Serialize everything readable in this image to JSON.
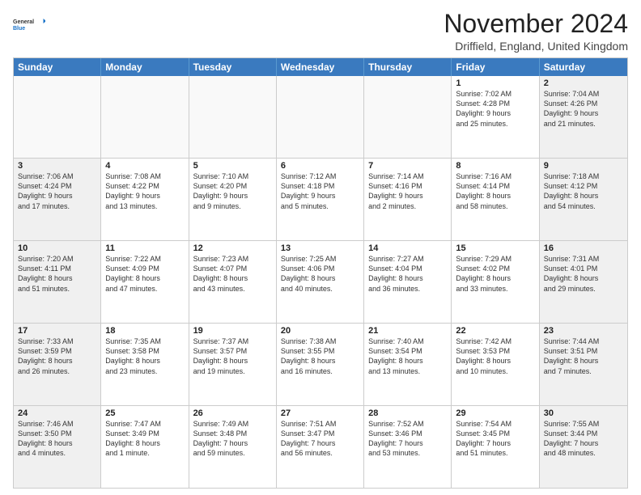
{
  "logo": {
    "general": "General",
    "blue": "Blue"
  },
  "title": "November 2024",
  "location": "Driffield, England, United Kingdom",
  "headers": [
    "Sunday",
    "Monday",
    "Tuesday",
    "Wednesday",
    "Thursday",
    "Friday",
    "Saturday"
  ],
  "rows": [
    [
      {
        "day": "",
        "info": ""
      },
      {
        "day": "",
        "info": ""
      },
      {
        "day": "",
        "info": ""
      },
      {
        "day": "",
        "info": ""
      },
      {
        "day": "",
        "info": ""
      },
      {
        "day": "1",
        "info": "Sunrise: 7:02 AM\nSunset: 4:28 PM\nDaylight: 9 hours\nand 25 minutes."
      },
      {
        "day": "2",
        "info": "Sunrise: 7:04 AM\nSunset: 4:26 PM\nDaylight: 9 hours\nand 21 minutes."
      }
    ],
    [
      {
        "day": "3",
        "info": "Sunrise: 7:06 AM\nSunset: 4:24 PM\nDaylight: 9 hours\nand 17 minutes."
      },
      {
        "day": "4",
        "info": "Sunrise: 7:08 AM\nSunset: 4:22 PM\nDaylight: 9 hours\nand 13 minutes."
      },
      {
        "day": "5",
        "info": "Sunrise: 7:10 AM\nSunset: 4:20 PM\nDaylight: 9 hours\nand 9 minutes."
      },
      {
        "day": "6",
        "info": "Sunrise: 7:12 AM\nSunset: 4:18 PM\nDaylight: 9 hours\nand 5 minutes."
      },
      {
        "day": "7",
        "info": "Sunrise: 7:14 AM\nSunset: 4:16 PM\nDaylight: 9 hours\nand 2 minutes."
      },
      {
        "day": "8",
        "info": "Sunrise: 7:16 AM\nSunset: 4:14 PM\nDaylight: 8 hours\nand 58 minutes."
      },
      {
        "day": "9",
        "info": "Sunrise: 7:18 AM\nSunset: 4:12 PM\nDaylight: 8 hours\nand 54 minutes."
      }
    ],
    [
      {
        "day": "10",
        "info": "Sunrise: 7:20 AM\nSunset: 4:11 PM\nDaylight: 8 hours\nand 51 minutes."
      },
      {
        "day": "11",
        "info": "Sunrise: 7:22 AM\nSunset: 4:09 PM\nDaylight: 8 hours\nand 47 minutes."
      },
      {
        "day": "12",
        "info": "Sunrise: 7:23 AM\nSunset: 4:07 PM\nDaylight: 8 hours\nand 43 minutes."
      },
      {
        "day": "13",
        "info": "Sunrise: 7:25 AM\nSunset: 4:06 PM\nDaylight: 8 hours\nand 40 minutes."
      },
      {
        "day": "14",
        "info": "Sunrise: 7:27 AM\nSunset: 4:04 PM\nDaylight: 8 hours\nand 36 minutes."
      },
      {
        "day": "15",
        "info": "Sunrise: 7:29 AM\nSunset: 4:02 PM\nDaylight: 8 hours\nand 33 minutes."
      },
      {
        "day": "16",
        "info": "Sunrise: 7:31 AM\nSunset: 4:01 PM\nDaylight: 8 hours\nand 29 minutes."
      }
    ],
    [
      {
        "day": "17",
        "info": "Sunrise: 7:33 AM\nSunset: 3:59 PM\nDaylight: 8 hours\nand 26 minutes."
      },
      {
        "day": "18",
        "info": "Sunrise: 7:35 AM\nSunset: 3:58 PM\nDaylight: 8 hours\nand 23 minutes."
      },
      {
        "day": "19",
        "info": "Sunrise: 7:37 AM\nSunset: 3:57 PM\nDaylight: 8 hours\nand 19 minutes."
      },
      {
        "day": "20",
        "info": "Sunrise: 7:38 AM\nSunset: 3:55 PM\nDaylight: 8 hours\nand 16 minutes."
      },
      {
        "day": "21",
        "info": "Sunrise: 7:40 AM\nSunset: 3:54 PM\nDaylight: 8 hours\nand 13 minutes."
      },
      {
        "day": "22",
        "info": "Sunrise: 7:42 AM\nSunset: 3:53 PM\nDaylight: 8 hours\nand 10 minutes."
      },
      {
        "day": "23",
        "info": "Sunrise: 7:44 AM\nSunset: 3:51 PM\nDaylight: 8 hours\nand 7 minutes."
      }
    ],
    [
      {
        "day": "24",
        "info": "Sunrise: 7:46 AM\nSunset: 3:50 PM\nDaylight: 8 hours\nand 4 minutes."
      },
      {
        "day": "25",
        "info": "Sunrise: 7:47 AM\nSunset: 3:49 PM\nDaylight: 8 hours\nand 1 minute."
      },
      {
        "day": "26",
        "info": "Sunrise: 7:49 AM\nSunset: 3:48 PM\nDaylight: 7 hours\nand 59 minutes."
      },
      {
        "day": "27",
        "info": "Sunrise: 7:51 AM\nSunset: 3:47 PM\nDaylight: 7 hours\nand 56 minutes."
      },
      {
        "day": "28",
        "info": "Sunrise: 7:52 AM\nSunset: 3:46 PM\nDaylight: 7 hours\nand 53 minutes."
      },
      {
        "day": "29",
        "info": "Sunrise: 7:54 AM\nSunset: 3:45 PM\nDaylight: 7 hours\nand 51 minutes."
      },
      {
        "day": "30",
        "info": "Sunrise: 7:55 AM\nSunset: 3:44 PM\nDaylight: 7 hours\nand 48 minutes."
      }
    ]
  ]
}
